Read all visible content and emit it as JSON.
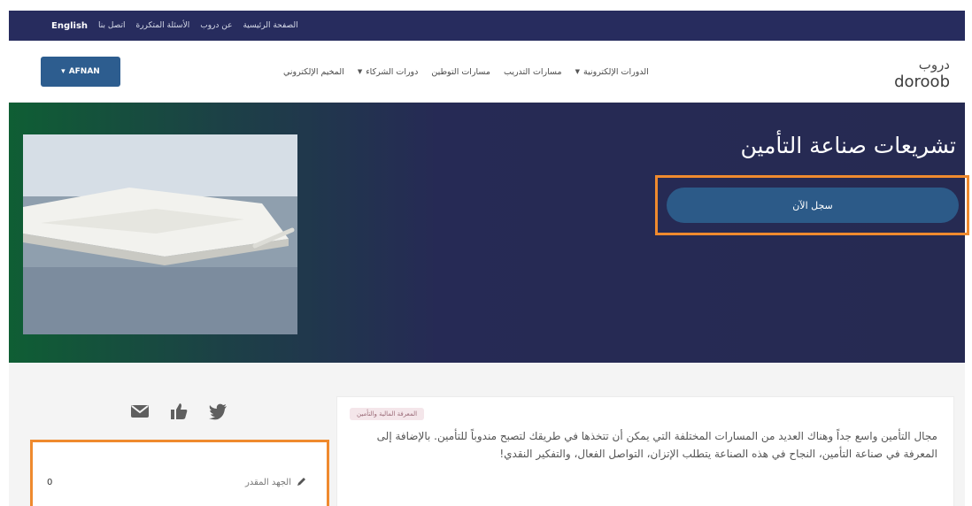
{
  "topbar": {
    "links": [
      "English",
      "اتصل بنا",
      "الأسئلة المتكررة",
      "عن دروب",
      "الصفحة الرئيسية"
    ]
  },
  "navbar": {
    "user_button": "AFNAN",
    "menu": [
      {
        "label": "الدورات الإلكترونية",
        "dropdown": true
      },
      {
        "label": "مسارات التدريب",
        "dropdown": false
      },
      {
        "label": "مسارات التوطين",
        "dropdown": false
      },
      {
        "label": "دورات الشركاء",
        "dropdown": true
      },
      {
        "label": "المخيم الإلكتروني",
        "dropdown": false
      }
    ],
    "logo_text": "doroob",
    "logo_arabic": "دروب"
  },
  "hero": {
    "title": "تشريعات صناعة التأمين",
    "register_button": "سجل الآن"
  },
  "sidebar": {
    "share_icons": [
      "email-icon",
      "thumbs-up-icon",
      "twitter-icon"
    ],
    "effort_label": "الجهد المقدر",
    "effort_value": "0"
  },
  "course": {
    "tag": "المعرفة المالية والتأمين",
    "description": "مجال التأمين واسع جداً وهناك العديد من المسارات المختلفة التي يمكن أن تتخذها في طريقك لتصبح مندوباً للتأمين. بالإضافة إلى المعرفة في صناعة التأمين، النجاح في هذه الصناعة يتطلب الإتزان، التواصل الفعال، والتفكير النقدي!"
  },
  "colors": {
    "topbar": "#272c5e",
    "primary_button": "#2c5a88",
    "highlight": "#ef8a2e",
    "hero_green": "#0f5e34",
    "hero_navy": "#262a55"
  }
}
